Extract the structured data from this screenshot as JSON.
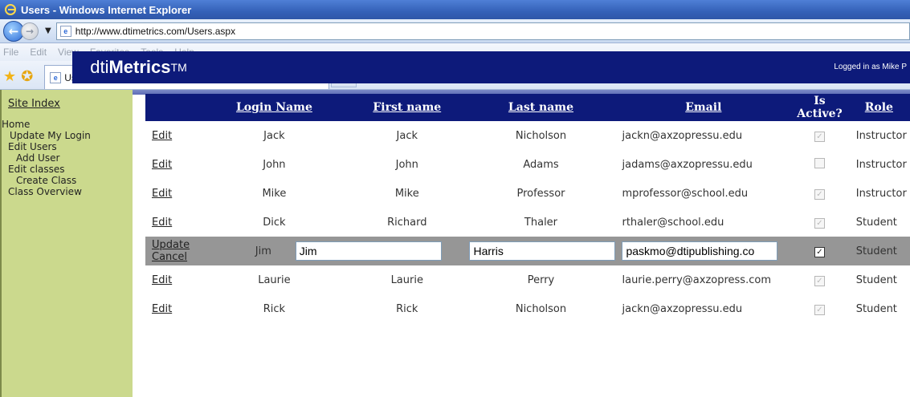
{
  "window": {
    "title": "Users - Windows Internet Explorer"
  },
  "address_bar": {
    "url": "http://www.dtimetrics.com/Users.aspx"
  },
  "menu_bar": [
    "File",
    "Edit",
    "View",
    "Favorites",
    "Tools",
    "Help"
  ],
  "tab": {
    "title": "Users"
  },
  "header": {
    "logo_prefix": "dti",
    "logo_bold": "Metrics",
    "logo_tm": "TM",
    "logged_in": "Logged in as Mike P"
  },
  "sidebar": {
    "site_index": "Site Index",
    "items": [
      "Home",
      "Update My Login",
      "Edit Users",
      "Add User",
      "Edit classes",
      "Create Class",
      "Class Overview"
    ]
  },
  "table": {
    "headers": [
      "",
      "Login Name",
      "First name",
      "Last name",
      "Email",
      "Is Active?",
      "Role"
    ],
    "edit_label": "Edit",
    "update_label": "Update",
    "cancel_label": "Cancel",
    "rows": [
      {
        "login": "Jack",
        "first": "Jack",
        "last": "Nicholson",
        "email": "jackn@axzopressu.edu",
        "active": true,
        "role": "Instructor"
      },
      {
        "login": "John",
        "first": "John",
        "last": "Adams",
        "email": "jadams@axzopressu.edu",
        "active": false,
        "role": "Instructor"
      },
      {
        "login": "Mike",
        "first": "Mike",
        "last": "Professor",
        "email": "mprofessor@school.edu",
        "active": true,
        "role": "Instructor"
      },
      {
        "login": "Dick",
        "first": "Richard",
        "last": "Thaler",
        "email": "rthaler@school.edu",
        "active": true,
        "role": "Student"
      },
      {
        "login": "Jim",
        "first": "Jim",
        "last": "Harris",
        "email": "paskmo@dtipublishing.co",
        "active": true,
        "role": "Student"
      },
      {
        "login": "Laurie",
        "first": "Laurie",
        "last": "Perry",
        "email": "laurie.perry@axzopress.com",
        "active": true,
        "role": "Student"
      },
      {
        "login": "Rick",
        "first": "Rick",
        "last": "Nicholson",
        "email": "jackn@axzopressu.edu",
        "active": true,
        "role": "Student"
      }
    ]
  }
}
